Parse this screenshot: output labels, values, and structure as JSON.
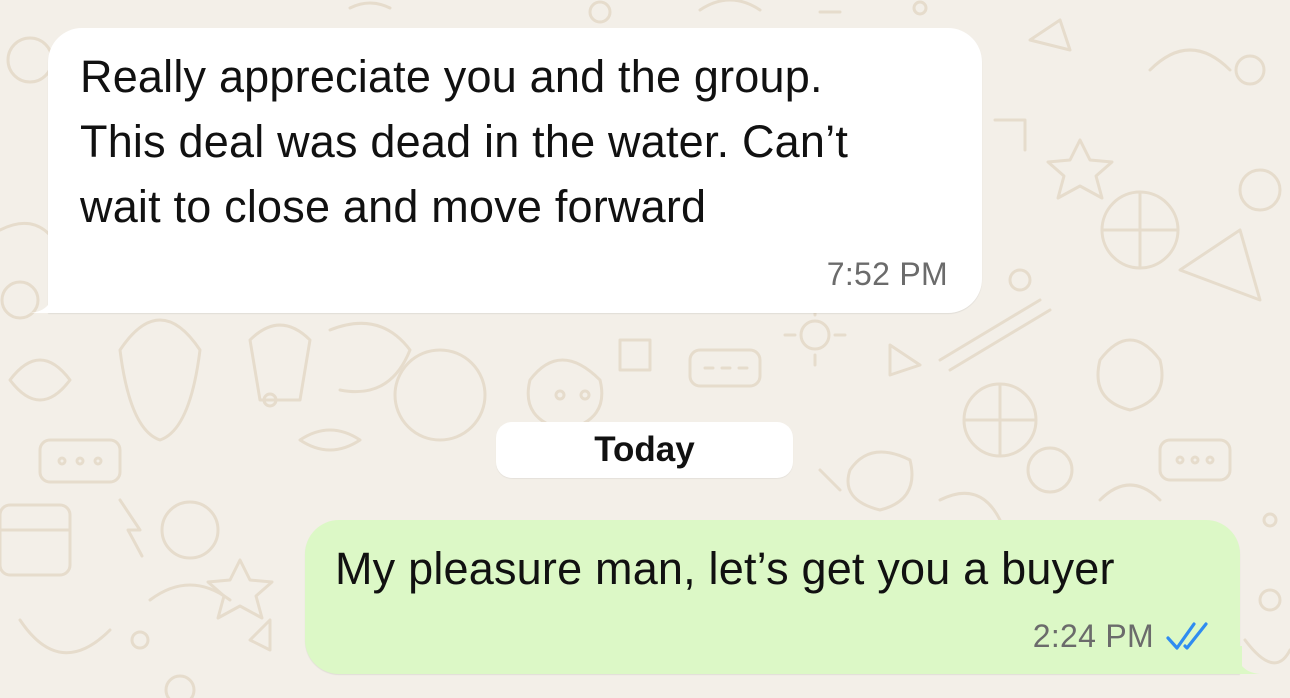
{
  "chat": {
    "messages": [
      {
        "direction": "incoming",
        "text": "Really appreciate you and the group.\nThis deal was dead in the water. Can’t\nwait to close and move forward",
        "time": "7:52 PM"
      },
      {
        "direction": "outgoing",
        "text": "My pleasure man, let’s get you a buyer",
        "time": "2:24 PM",
        "status_icon": "double-check-read-icon"
      }
    ],
    "date_separator": "Today"
  },
  "colors": {
    "wallpaper": "#f3efe8",
    "wallpaper_doodle": "#e6dccc",
    "incoming_bubble": "#ffffff",
    "outgoing_bubble": "#dcf8c6",
    "read_ticks": "#2f8cf0",
    "timestamp": "#6b6b6b"
  }
}
